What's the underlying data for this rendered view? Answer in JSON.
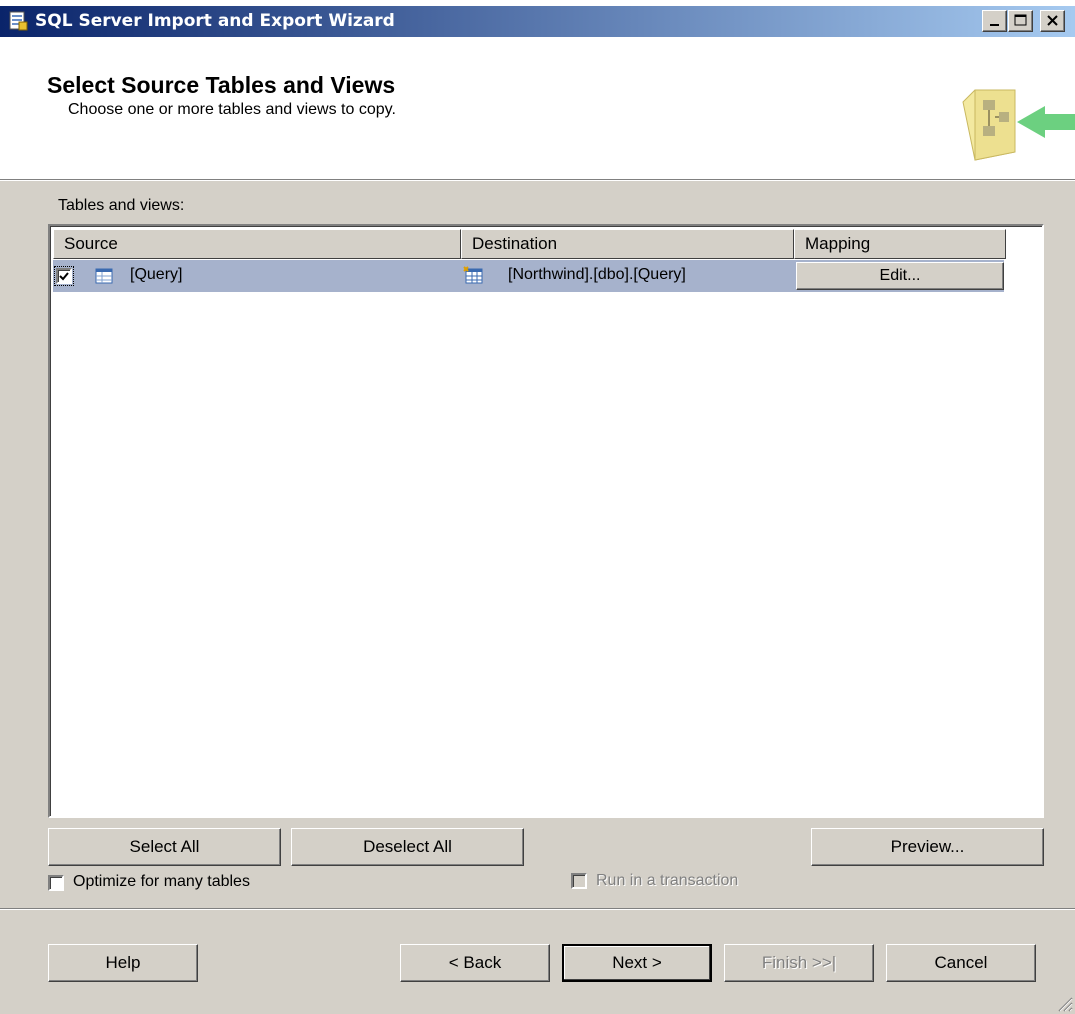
{
  "window": {
    "title": "SQL Server Import and Export Wizard",
    "caption_buttons": [
      "minimize-icon",
      "maximize-icon",
      "close-icon"
    ]
  },
  "header": {
    "title": "Select Source Tables and Views",
    "subtitle": "Choose one or more tables and views to copy."
  },
  "tables": {
    "label": "Tables and views:",
    "columns": [
      "Source",
      "Destination",
      "Mapping"
    ],
    "rows": [
      {
        "checked": true,
        "source": "[Query]",
        "destination": "[Northwind].[dbo].[Query]",
        "mapping": "Edit..."
      }
    ]
  },
  "list_buttons": {
    "select_all": "Select All",
    "deselect_all": "Deselect All",
    "preview": "Preview..."
  },
  "options": {
    "optimize": "Optimize for many tables",
    "transaction": "Run in a transaction"
  },
  "nav": {
    "help": "Help",
    "back": "< Back",
    "next": "Next >",
    "finish": "Finish >>|",
    "cancel": "Cancel"
  },
  "colors": {
    "titlebar_start": "#0a246a",
    "titlebar_end": "#a6caf0",
    "face": "#d4d0c8",
    "selection": "#a6b2cc"
  }
}
